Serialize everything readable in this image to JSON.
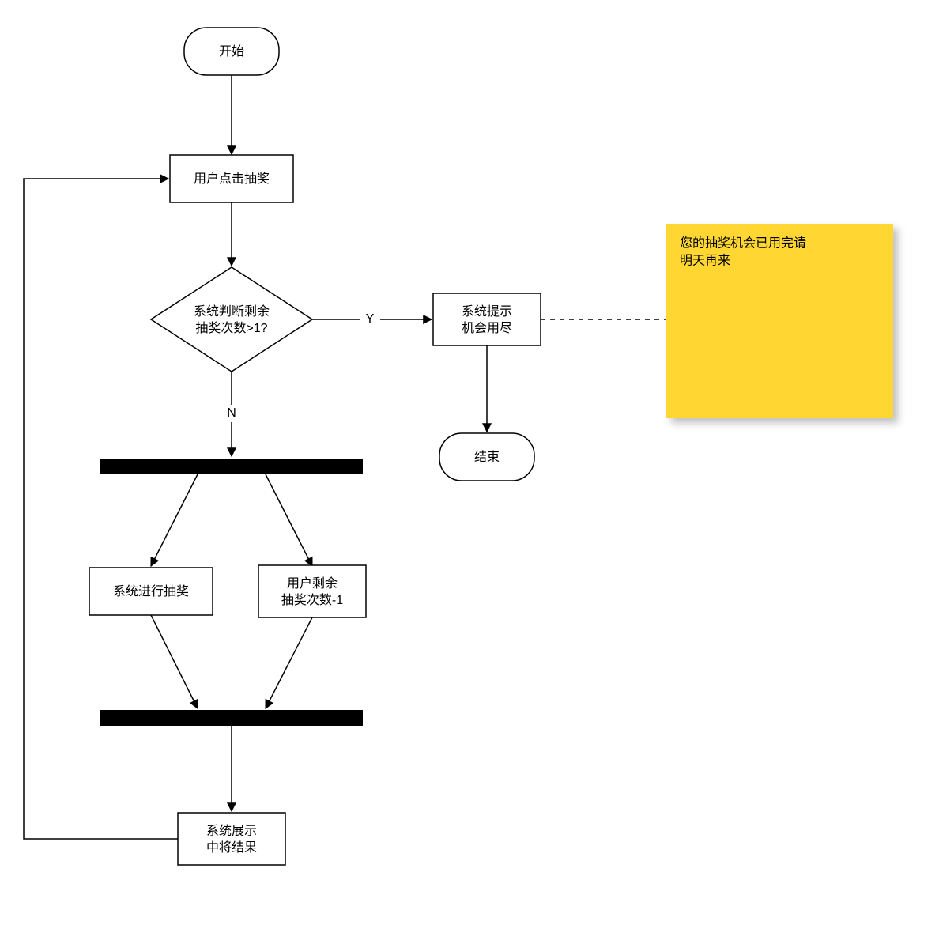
{
  "nodes": {
    "start": "开始",
    "user_click": "用户点击抽奖",
    "decision_line1": "系统判断剩余",
    "decision_line2": "抽奖次数>1?",
    "prompt_line1": "系统提示",
    "prompt_line2": "机会用尽",
    "end": "结束",
    "parallel_left": "系统进行抽奖",
    "parallel_right_line1": "用户剩余",
    "parallel_right_line2": "抽奖次数-1",
    "show_result_line1": "系统展示",
    "show_result_line2": "中将结果"
  },
  "edges": {
    "yes": "Y",
    "no": "N"
  },
  "note": {
    "line1": "您的抽奖机会已用完请",
    "line2": "明天再来"
  },
  "colors": {
    "note_bg": "#ffd633"
  }
}
